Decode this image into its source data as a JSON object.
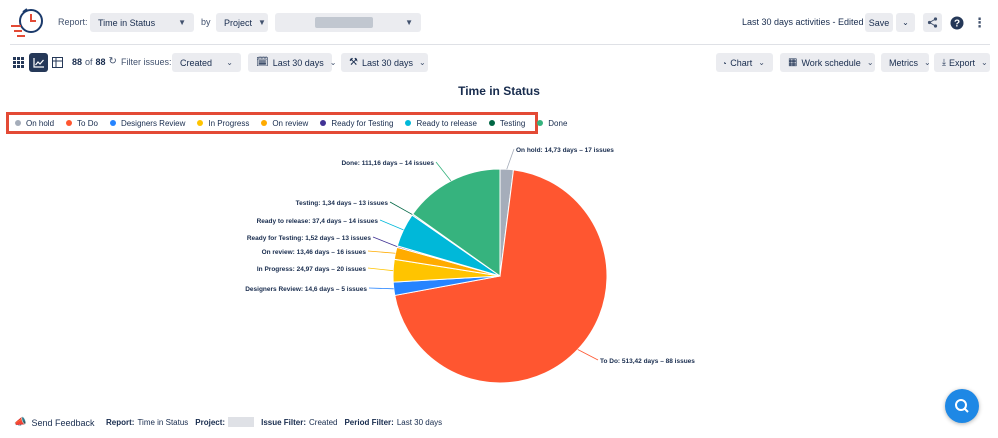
{
  "header": {
    "report_label": "Report:",
    "report_value": "Time in Status",
    "by_label": "by",
    "by_value": "Project",
    "project_value": "",
    "status_text": "Last 30 days activities - Edited",
    "save_label": "Save"
  },
  "toolbar": {
    "count_current": "88",
    "count_of": "of",
    "count_total": "88",
    "filter_label": "Filter issues:",
    "filter_value": "Created",
    "period1": "Last 30 days",
    "period2": "Last 30 days",
    "chart_label": "Chart",
    "work_schedule_label": "Work schedule",
    "metrics_label": "Metrics",
    "export_label": "Export"
  },
  "colors": {
    "on_hold": "#a5adba",
    "to_do": "#ff5630",
    "designers_review": "#2684ff",
    "in_progress": "#ffc400",
    "on_review": "#ffab00",
    "ready_for_testing": "#403294",
    "ready_to_release": "#00b8d9",
    "testing": "#006644",
    "done": "#36b37e"
  },
  "chart_data": {
    "type": "pie",
    "title": "Time in Status",
    "legend_position": "top-left",
    "series": [
      {
        "name": "On hold",
        "days": 14.73,
        "issues": 17,
        "label": "On hold: 14,73 days – 17 issues",
        "color": "#a5adba"
      },
      {
        "name": "To Do",
        "days": 513.42,
        "issues": 88,
        "label": "To Do: 513,42 days – 88 issues",
        "color": "#ff5630"
      },
      {
        "name": "Designers Review",
        "days": 14.6,
        "issues": 5,
        "label": "Designers Review: 14,6 days – 5 issues",
        "color": "#2684ff"
      },
      {
        "name": "In Progress",
        "days": 24.97,
        "issues": 20,
        "label": "In Progress: 24,97 days – 20 issues",
        "color": "#ffc400"
      },
      {
        "name": "On review",
        "days": 13.46,
        "issues": 16,
        "label": "On review: 13,46 days – 16 issues",
        "color": "#ffab00"
      },
      {
        "name": "Ready for Testing",
        "days": 1.52,
        "issues": 13,
        "label": "Ready for Testing: 1,52 days – 13 issues",
        "color": "#403294"
      },
      {
        "name": "Ready to release",
        "days": 37.4,
        "issues": 14,
        "label": "Ready to release: 37,4 days – 14 issues",
        "color": "#00b8d9"
      },
      {
        "name": "Testing",
        "days": 1.34,
        "issues": 13,
        "label": "Testing: 1,34 days – 13 issues",
        "color": "#006644"
      },
      {
        "name": "Done",
        "days": 111.16,
        "issues": 14,
        "label": "Done: 111,16 days – 14 issues",
        "color": "#36b37e"
      }
    ]
  },
  "footer": {
    "feedback": "Send Feedback",
    "report_key": "Report:",
    "report_val": "Time in Status",
    "project_key": "Project:",
    "issue_filter_key": "Issue Filter:",
    "issue_filter_val": "Created",
    "period_key": "Period Filter:",
    "period_val": "Last 30 days"
  }
}
